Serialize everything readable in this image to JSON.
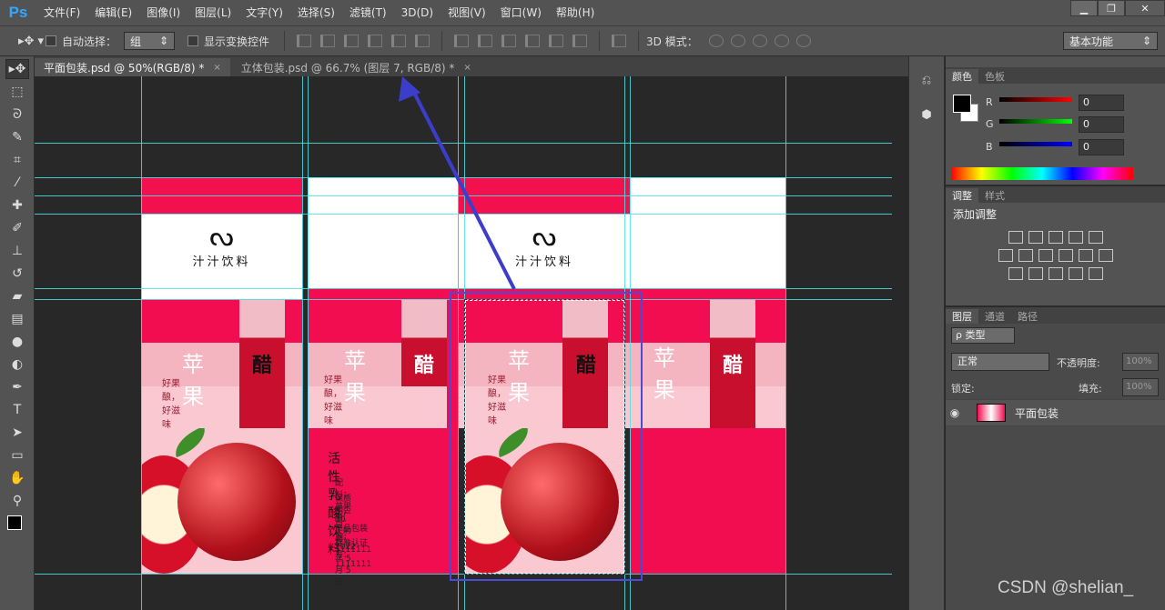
{
  "app": {
    "logo": "Ps"
  },
  "menu": [
    "文件(F)",
    "编辑(E)",
    "图像(I)",
    "图层(L)",
    "文字(Y)",
    "选择(S)",
    "滤镜(T)",
    "3D(D)",
    "视图(V)",
    "窗口(W)",
    "帮助(H)"
  ],
  "window": {
    "min": "▁",
    "restore": "❐",
    "close": "✕"
  },
  "options": {
    "auto_select_label": "自动选择：",
    "auto_select_value": "组",
    "show_transform_label": "显示变换控件",
    "mode_3d_label": "3D 模式：",
    "workspace": "基本功能"
  },
  "tabs": [
    {
      "label": "平面包装.psd @ 50%(RGB/8) *",
      "close": "×",
      "active": true
    },
    {
      "label": "立体包装.psd @ 66.7% (图层 7, RGB/8) *",
      "close": "×",
      "active": false
    }
  ],
  "design": {
    "brand": "汁汁饮料",
    "flame": "ᔓ",
    "product": "苹果",
    "slogan": "好果酿，好滋味",
    "vinegar": "醋",
    "info_title": "活性乳酸饮料",
    "info_lines": [
      "配料：苹果酿、牛奶",
      "保质期：30 天",
      "生产日期：2022 年 5 月 5 日",
      "产品包装号：1111111",
      "标准认证号：1111111"
    ]
  },
  "color_panel": {
    "tabs": [
      "颜色",
      "色板"
    ],
    "r_label": "R",
    "r": "0",
    "g_label": "G",
    "g": "0",
    "b_label": "B",
    "b": "0"
  },
  "adjust_panel": {
    "tabs": [
      "调整",
      "样式"
    ],
    "title": "添加调整"
  },
  "layers_panel": {
    "tabs": [
      "图层",
      "通道",
      "路径"
    ],
    "filter": "ρ 类型",
    "blend": "正常",
    "opacity_label": "不透明度:",
    "opacity": "100%",
    "lock_label": "锁定:",
    "fill_label": "填充:",
    "fill": "100%",
    "layer_name": "平面包装"
  },
  "watermark": "CSDN @shelian_",
  "colors": {
    "accent": "#f20c50",
    "deep": "#c8102e",
    "guide": "#4de0e6",
    "selection": "#4a4ad8"
  }
}
